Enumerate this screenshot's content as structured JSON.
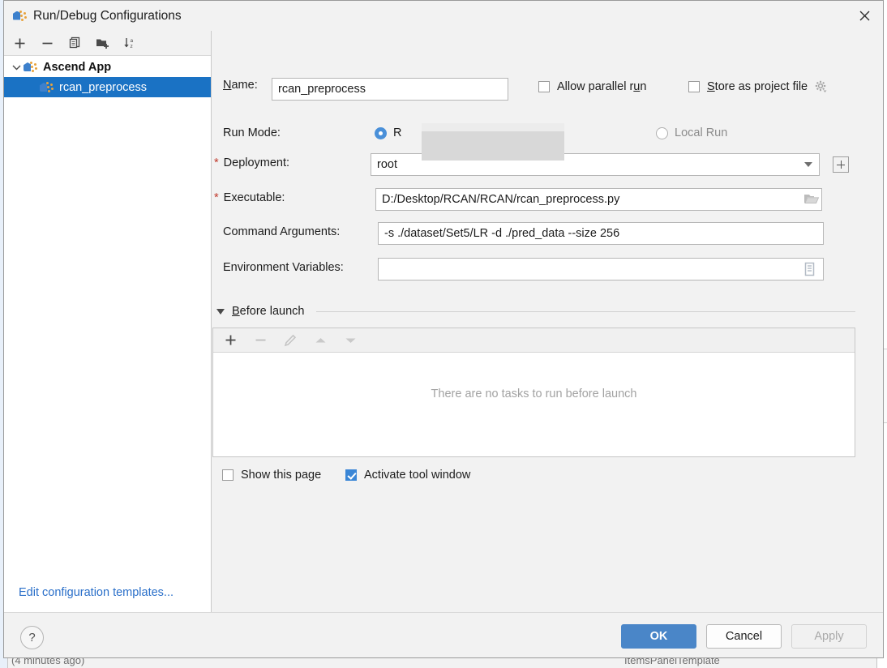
{
  "window": {
    "title": "Run/Debug Configurations",
    "icon": "ascend-app-icon",
    "close_icon": "close-icon"
  },
  "tree_toolbar": {
    "buttons": [
      {
        "name": "add-configuration-button",
        "icon": "plus-icon",
        "enabled": true
      },
      {
        "name": "remove-configuration-button",
        "icon": "minus-icon",
        "enabled": true
      },
      {
        "name": "copy-configuration-button",
        "icon": "copy-icon",
        "enabled": true
      },
      {
        "name": "new-folder-button",
        "icon": "folder-add-icon",
        "enabled": true
      },
      {
        "name": "sort-configurations-button",
        "icon": "sort-alpha-icon",
        "enabled": true
      }
    ]
  },
  "tree": {
    "group_label": "Ascend App",
    "child_label": "rcan_preprocess",
    "expanded": true,
    "selected": "rcan_preprocess"
  },
  "left_pane": {
    "edit_templates_link": "Edit configuration templates..."
  },
  "form": {
    "name_label": "Name:",
    "name_mnemonic": "N",
    "name_value": "rcan_preprocess",
    "allow_parallel_run_label": "Allow parallel run",
    "allow_parallel_run_checked": false,
    "store_as_project_file_label": "Store as project file",
    "store_as_project_file_checked": false,
    "store_gear_icon": "gear-icon",
    "run_mode_label": "Run Mode:",
    "run_mode_remote_label": "R",
    "run_mode_remote_selected": true,
    "run_mode_local_label": "Local Run",
    "run_mode_local_selected": false,
    "run_mode_local_enabled": false,
    "deployment_label": "Deployment:",
    "deployment_required": "*",
    "deployment_value": "root",
    "deployment_add_button_icon": "plus-box-icon",
    "executable_label": "Executable:",
    "executable_required": "*",
    "executable_value": "D:/Desktop/RCAN/RCAN/rcan_preprocess.py",
    "executable_browse_icon": "folder-open-icon",
    "command_arguments_label": "Command Arguments:",
    "command_arguments_value": "-s ./dataset/Set5/LR -d ./pred_data --size 256",
    "environment_variables_label": "Environment Variables:",
    "environment_variables_value": "",
    "environment_variables_icon": "list-edit-icon"
  },
  "before_launch": {
    "title": "Before launch",
    "title_mnemonic": "B",
    "expanded": true,
    "toolbar": [
      {
        "name": "add-task-button",
        "icon": "plus-icon",
        "enabled": true
      },
      {
        "name": "remove-task-button",
        "icon": "minus-icon",
        "enabled": false
      },
      {
        "name": "edit-task-button",
        "icon": "pencil-icon",
        "enabled": false
      },
      {
        "name": "move-task-up-button",
        "icon": "arrow-up-icon",
        "enabled": false
      },
      {
        "name": "move-task-down-button",
        "icon": "arrow-down-icon",
        "enabled": false
      }
    ],
    "empty_message": "There are no tasks to run before launch",
    "show_this_page_label": "Show this page",
    "show_this_page_checked": false,
    "activate_tool_window_label": "Activate tool window",
    "activate_tool_window_checked": true
  },
  "footer": {
    "help_label": "?",
    "ok_label": "OK",
    "cancel_label": "Cancel",
    "apply_label": "Apply",
    "apply_enabled": false
  },
  "background": {
    "left_text": "(4 minutes ago)",
    "right_text": "ItemsPanelTemplate"
  },
  "colors": {
    "accent": "#4a86c8",
    "selection": "#1a72c4",
    "link": "#2a6fc9",
    "required": "#c0392b",
    "dialog_bg": "#f2f2f2",
    "redaction": "#d8d8d8"
  }
}
